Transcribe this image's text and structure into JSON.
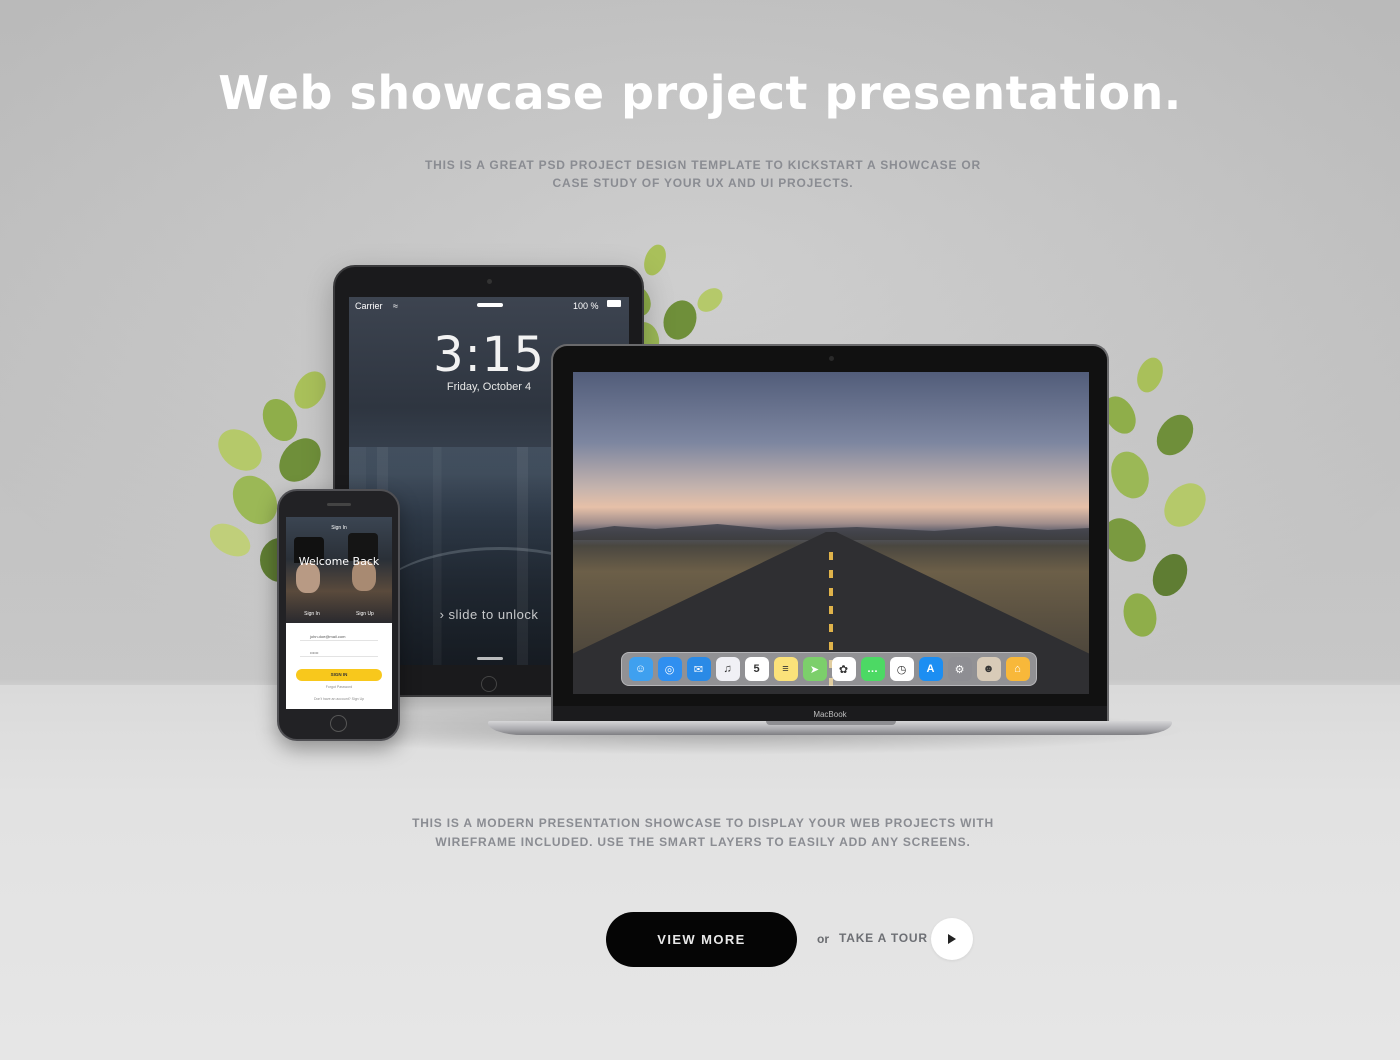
{
  "hero": {
    "title": "Web showcase project presentation.",
    "subtitle": "THIS IS A GREAT PSD PROJECT DESIGN TEMPLATE TO KICKSTART A SHOWCASE OR CASE STUDY OF YOUR UX AND UI PROJECTS."
  },
  "tablet": {
    "carrier": "Carrier",
    "battery": "100 %",
    "time": "3:15",
    "date": "Friday, October 4",
    "unlock": "slide to unlock"
  },
  "phone": {
    "header": "Sign In",
    "welcome": "Welcome Back",
    "tab_signin": "Sign In",
    "tab_signup": "Sign Up",
    "email": "john.doe@mail.com",
    "password": "••••••",
    "button": "SIGN IN",
    "forgot": "Forgot Password",
    "footer": "Don't have an account? Sign Up"
  },
  "laptop": {
    "label": "MacBook",
    "dock_icons": [
      {
        "name": "finder-icon",
        "color": "#3fa0ef",
        "glyph": "☺"
      },
      {
        "name": "safari-icon",
        "color": "#2f8ff0",
        "glyph": "◎"
      },
      {
        "name": "mail-icon",
        "color": "#2a8ae6",
        "glyph": "✉"
      },
      {
        "name": "itunes-icon",
        "color": "#f0f0f5",
        "glyph": "♫"
      },
      {
        "name": "calendar-icon",
        "color": "#ffffff",
        "glyph": "5"
      },
      {
        "name": "notes-icon",
        "color": "#fbe27a",
        "glyph": "≡"
      },
      {
        "name": "maps-icon",
        "color": "#7ccf6b",
        "glyph": "➤"
      },
      {
        "name": "photos-icon",
        "color": "#ffffff",
        "glyph": "✿"
      },
      {
        "name": "messages-icon",
        "color": "#4cd964",
        "glyph": "…"
      },
      {
        "name": "clock-icon",
        "color": "#ffffff",
        "glyph": "◷"
      },
      {
        "name": "app-store-icon",
        "color": "#1c8ef2",
        "glyph": "A"
      },
      {
        "name": "settings-icon",
        "color": "#8e8e93",
        "glyph": "⚙"
      },
      {
        "name": "contacts-icon",
        "color": "#d8cbb8",
        "glyph": "☻"
      },
      {
        "name": "home-icon",
        "color": "#f8b83a",
        "glyph": "⌂"
      }
    ]
  },
  "description": "THIS IS A MODERN PRESENTATION SHOWCASE TO DISPLAY YOUR WEB PROJECTS WITH WIREFRAME INCLUDED. USE THE SMART LAYERS TO EASILY ADD ANY SCREENS.",
  "cta": {
    "view_more": "VIEW MORE",
    "or": "or",
    "take_tour": "TAKE A TOUR"
  }
}
